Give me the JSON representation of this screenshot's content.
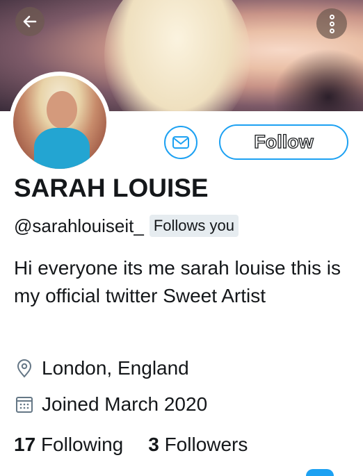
{
  "header": {
    "back_icon": "arrow-left-icon",
    "more_icon": "more-vertical-icon"
  },
  "profile": {
    "name": "SARAH LOUISE",
    "handle": "@sarahlouiseit_",
    "follows_you": "Follows you",
    "bio": "Hi everyone its me sarah louise this is my official twitter Sweet Artist",
    "location": "London, England",
    "joined": "Joined March 2020",
    "following_count": "17",
    "following_label": "Following",
    "followers_count": "3",
    "followers_label": "Followers"
  },
  "actions": {
    "follow_label": "Follow",
    "message_icon": "mail-icon"
  },
  "colors": {
    "accent": "#1da1f2",
    "text": "#14171a",
    "badge_bg": "#e6ecf0"
  }
}
